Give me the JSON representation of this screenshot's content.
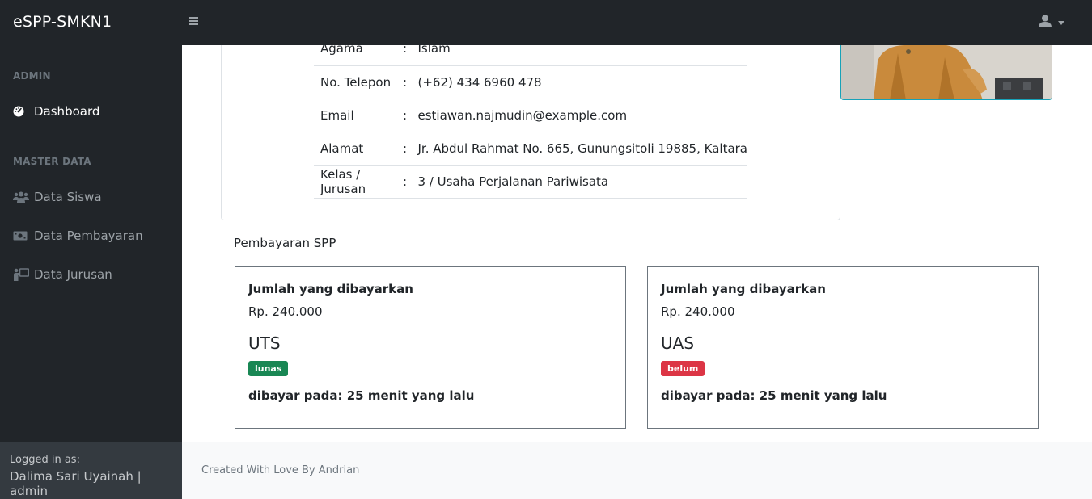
{
  "app": {
    "brand": "eSPP-SMKN1"
  },
  "sidebar": {
    "headings": [
      "ADMIN",
      "MASTER DATA"
    ],
    "items": [
      {
        "label": "Dashboard",
        "icon": "dashboard-icon",
        "active": true
      },
      {
        "label": "Data Siswa",
        "icon": "users-icon"
      },
      {
        "label": "Data Pembayaran",
        "icon": "money-icon"
      },
      {
        "label": "Data Jurusan",
        "icon": "chalkboard-icon"
      }
    ],
    "footer": {
      "label": "Logged in as:",
      "user": "Dalima Sari Uyainah | admin"
    }
  },
  "profile": {
    "rows": [
      {
        "key": "Agama",
        "sep": ":",
        "value": "Islam"
      },
      {
        "key": "No. Telepon",
        "sep": ":",
        "value": "(+62) 434 6960 478"
      },
      {
        "key": "Email",
        "sep": ":",
        "value": "estiawan.najmudin@example.com"
      },
      {
        "key": "Alamat",
        "sep": ":",
        "value": "Jr. Abdul Rahmat No. 665, Gunungsitoli 19885, Kaltara"
      },
      {
        "key": "Kelas / Jurusan",
        "sep": ":",
        "value": "3 / Usaha Perjalanan Pariwisata"
      }
    ]
  },
  "payments": {
    "title": "Pembayaran SPP",
    "cards": [
      {
        "label": "Jumlah yang dibayarkan",
        "amount": "Rp. 240.000",
        "name": "UTS",
        "status": "lunas",
        "status_color": "#198754",
        "paid": "dibayar pada: 25 menit yang lalu"
      },
      {
        "label": "Jumlah yang dibayarkan",
        "amount": "Rp. 240.000",
        "name": "UAS",
        "status": "belum",
        "status_color": "#dc3545",
        "paid": "dibayar pada: 25 menit yang lalu"
      }
    ]
  },
  "footer": {
    "text": "Created With Love By Andrian"
  },
  "colors": {
    "navbar": "#212529",
    "accent_border": "#17a2b8"
  }
}
